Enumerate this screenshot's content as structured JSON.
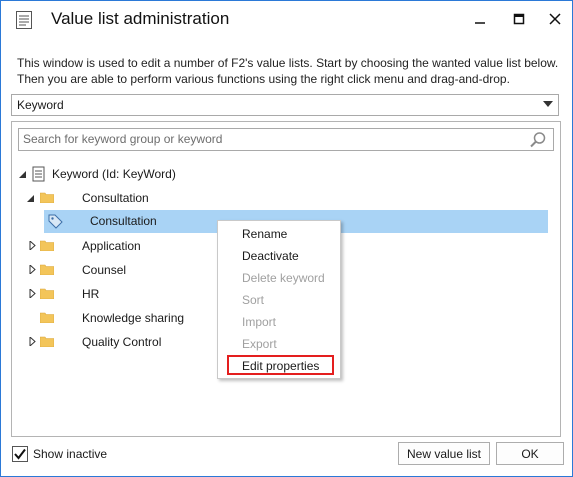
{
  "window": {
    "title": "Value list administration",
    "intro_line1": "This window is used to edit a number of F2's value lists. Start by choosing the wanted value list below.",
    "intro_line2": "Then you are able to perform various functions using the right click menu and drag-and-drop."
  },
  "selector": {
    "value": "Keyword"
  },
  "search": {
    "placeholder": "Search for keyword group or keyword"
  },
  "tree": {
    "root": "Keyword (Id: KeyWord)",
    "groups": [
      {
        "label": "Consultation",
        "expanded": true
      },
      {
        "label": "Consultation",
        "selected": true
      },
      {
        "label": "Application"
      },
      {
        "label": "Counsel"
      },
      {
        "label": "HR"
      },
      {
        "label": "Knowledge sharing"
      },
      {
        "label": "Quality Control"
      }
    ]
  },
  "context_menu": {
    "items": [
      {
        "label": "Rename",
        "enabled": true
      },
      {
        "label": "Deactivate",
        "enabled": true
      },
      {
        "label": "Delete keyword",
        "enabled": false
      },
      {
        "label": "Sort",
        "enabled": false
      },
      {
        "label": "Import",
        "enabled": false
      },
      {
        "label": "Export",
        "enabled": false
      },
      {
        "label": "Edit properties",
        "enabled": true,
        "highlighted": true
      }
    ]
  },
  "footer": {
    "show_inactive_label": "Show inactive",
    "show_inactive_checked": true,
    "new_value_list_label": "New value list",
    "ok_label": "OK"
  },
  "colors": {
    "selection": "#a9d3f5",
    "highlight_border": "#e41e1e",
    "window_border": "#2b79d7"
  }
}
